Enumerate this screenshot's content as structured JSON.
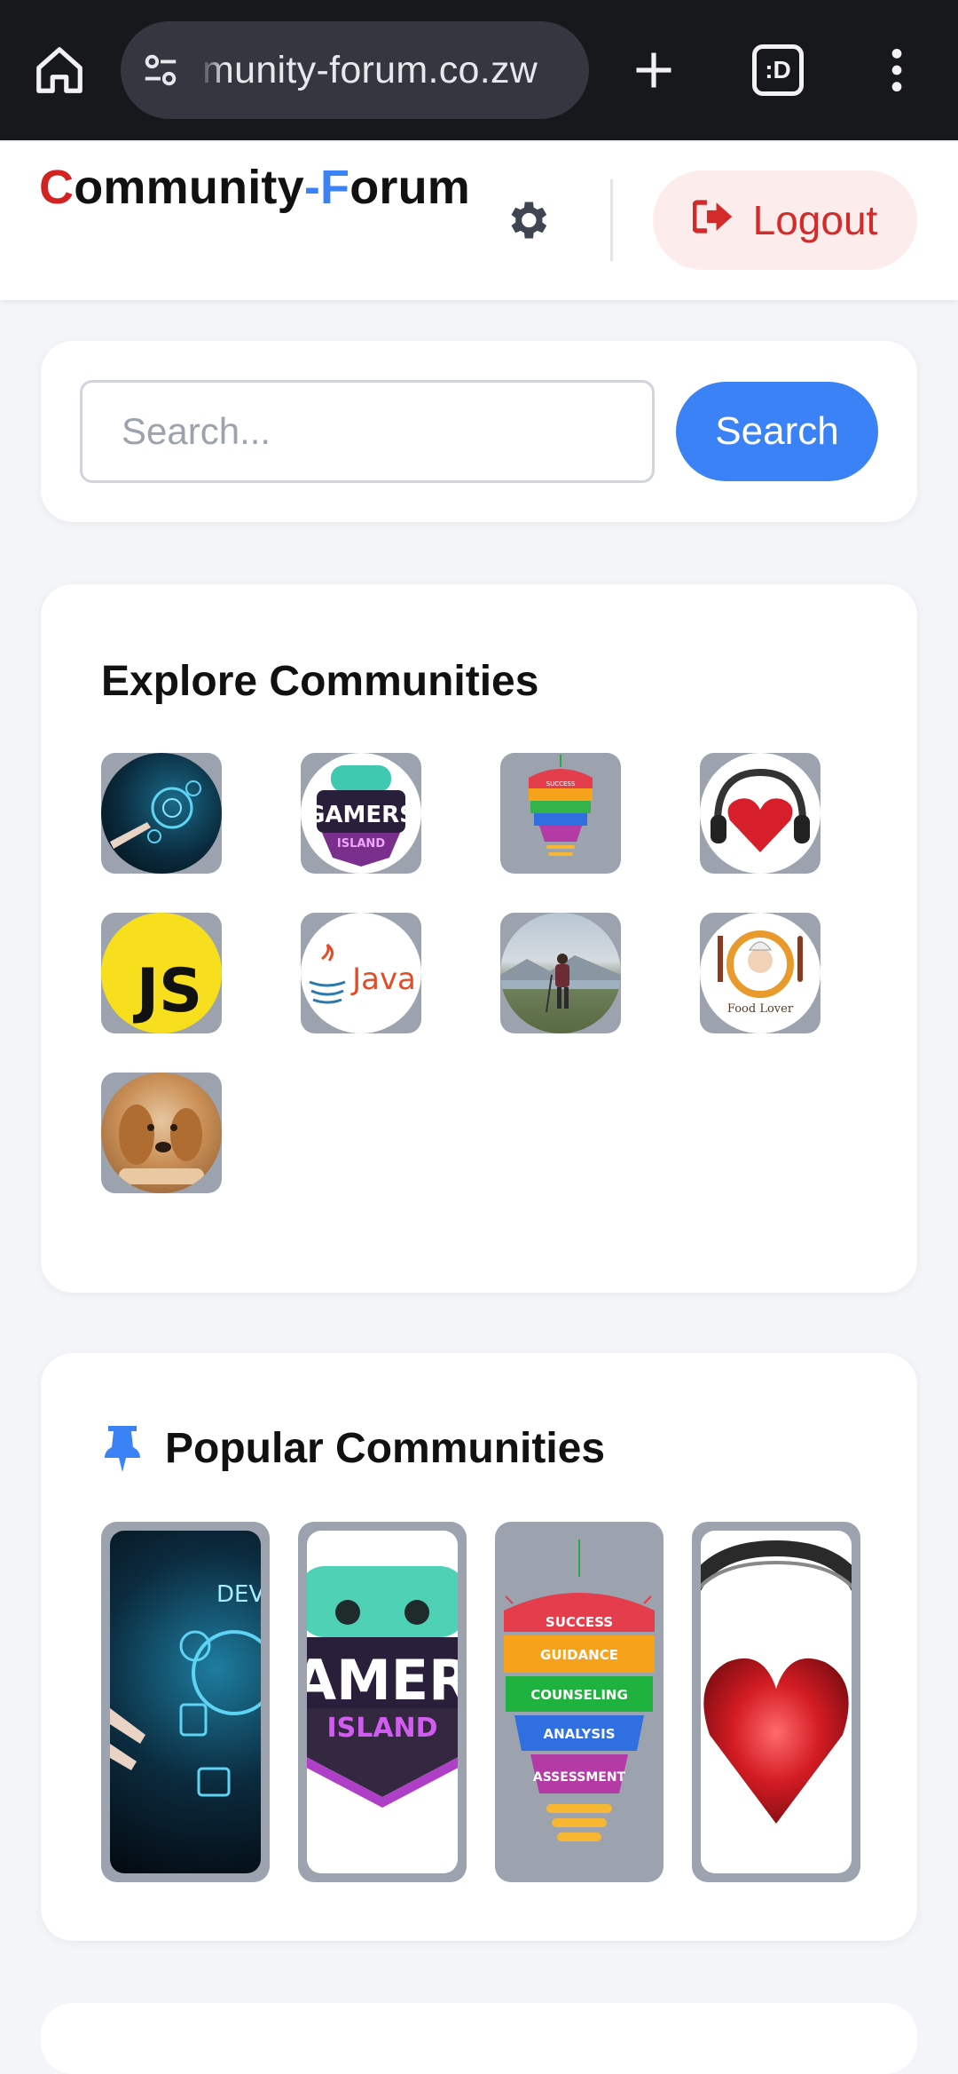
{
  "browser": {
    "url": "munity-forum.co.zw",
    "tab_count_label": ":D",
    "icons": [
      "home-icon",
      "site-settings-icon",
      "new-tab-icon",
      "tabs-icon",
      "menu-icon"
    ]
  },
  "header": {
    "logo_parts": [
      "C",
      "ommunity",
      "-",
      "F",
      "orum"
    ],
    "logout_label": "Logout",
    "colors": {
      "red": "#d32222",
      "blue": "#3b82f6"
    }
  },
  "search": {
    "placeholder": "Search...",
    "value": "",
    "button_label": "Search"
  },
  "explore": {
    "title": "Explore Communities",
    "communities": [
      {
        "name": "web-development",
        "icon": "web-developer-image"
      },
      {
        "name": "gamers-island",
        "icon": "gamers-island-image",
        "text": "GAMERS",
        "subtext": "ISLAND"
      },
      {
        "name": "success-guidance",
        "icon": "success-guidance-image",
        "text": "SUCCESS"
      },
      {
        "name": "music-love",
        "icon": "heart-headphones-image"
      },
      {
        "name": "javascript",
        "icon": "js-logo",
        "text": "JS"
      },
      {
        "name": "java",
        "icon": "java-logo",
        "text": "Java"
      },
      {
        "name": "hiking",
        "icon": "hiker-image"
      },
      {
        "name": "food-lover",
        "icon": "food-lover-logo",
        "text": "Food Lover"
      },
      {
        "name": "pets",
        "icon": "dog-image"
      }
    ]
  },
  "popular": {
    "title": "Popular Communities",
    "communities": [
      {
        "name": "web-development",
        "text": "DEVEL"
      },
      {
        "name": "gamers-island",
        "text": "AMER",
        "subtext": "ISLAND"
      },
      {
        "name": "success-guidance",
        "layers": [
          "SUCCESS",
          "GUIDANCE",
          "COUNSELING",
          "ANALYSIS",
          "ASSESSMENT"
        ]
      },
      {
        "name": "music-love"
      }
    ]
  }
}
